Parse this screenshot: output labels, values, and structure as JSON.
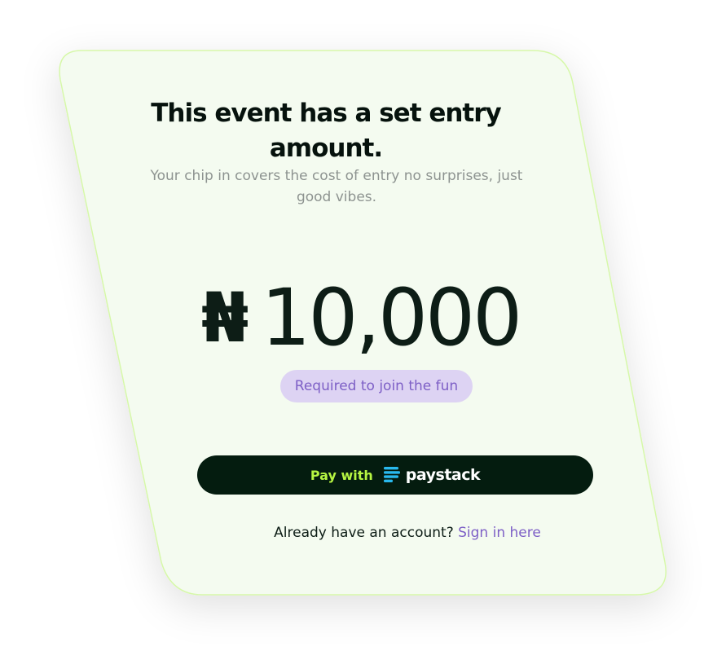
{
  "card": {
    "title": "This event has a set entry amount.",
    "subtitle": "Your chip in covers the cost of entry no surprises, just good vibes.",
    "amount": {
      "currency_symbol": "₦",
      "value": "10,000"
    },
    "badge": "Required to join the fun",
    "pay_button": {
      "label": "Pay with",
      "provider": "paystack",
      "provider_icon": "paystack-logo-icon"
    },
    "signin": {
      "prompt": "Already have an account?",
      "link": "Sign in here"
    }
  },
  "colors": {
    "card_background": "#f4fbf0",
    "card_border": "#d6f8a9",
    "title": "#06120d",
    "subtitle": "#8d9390",
    "amount": "#0d1d16",
    "badge_background": "#ddd3f3",
    "badge_text": "#7d5fc6",
    "button_background": "#041c0f",
    "button_label": "#b6f542",
    "paystack_accent": "#29b9ee",
    "link": "#7d5fc6"
  }
}
